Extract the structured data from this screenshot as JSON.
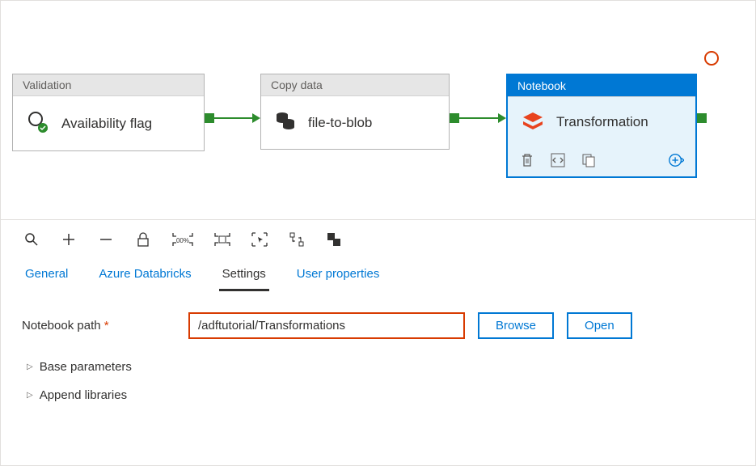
{
  "canvas": {
    "activities": {
      "validation": {
        "header": "Validation",
        "name": "Availability flag"
      },
      "copy": {
        "header": "Copy data",
        "name": "file-to-blob"
      },
      "notebook": {
        "header": "Notebook",
        "name": "Transformation"
      }
    }
  },
  "tabs": {
    "general": "General",
    "azure_databricks": "Azure Databricks",
    "settings": "Settings",
    "user_properties": "User properties"
  },
  "settings": {
    "notebook_path_label": "Notebook path",
    "notebook_path_value": "/adftutorial/Transformations",
    "browse": "Browse",
    "open": "Open",
    "base_parameters": "Base parameters",
    "append_libraries": "Append libraries"
  },
  "toolbar": {
    "zoom_label": "00%"
  }
}
